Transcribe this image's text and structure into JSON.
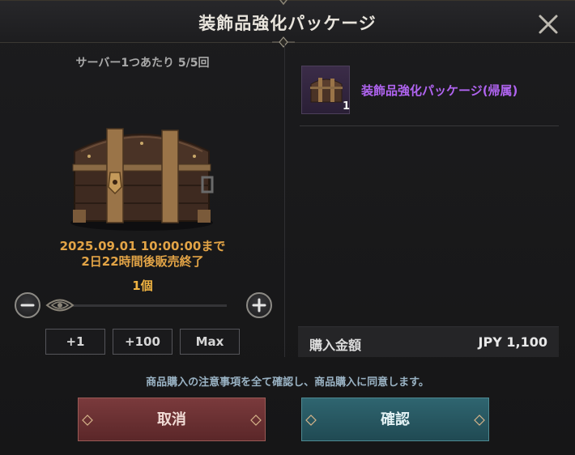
{
  "dialog": {
    "title": "装飾品強化パッケージ",
    "close_icon": "close-icon"
  },
  "left": {
    "purchase_limit": "サーバー1つあたり 5/5回",
    "item_image": "treasure-chest-image",
    "sale_end_date": "2025.09.01 10:00:00まで",
    "sale_remaining": "2日22時間後販売終了",
    "quantity_label": "1個",
    "quantity_fraction": 0.0,
    "step_buttons": [
      "+1",
      "+100",
      "Max"
    ]
  },
  "right": {
    "item": {
      "name": "装飾品強化パッケージ(帰属)",
      "count": "1",
      "name_color": "#b064f0"
    },
    "price_label": "購入金額",
    "price_value": "JPY 1,100"
  },
  "footer": {
    "notice": "商品購入の注意事項を全て確認し、商品購入に同意します。",
    "cancel_label": "取消",
    "confirm_label": "確認",
    "cancel_color": "#6b3133",
    "confirm_color": "#2a5862"
  }
}
